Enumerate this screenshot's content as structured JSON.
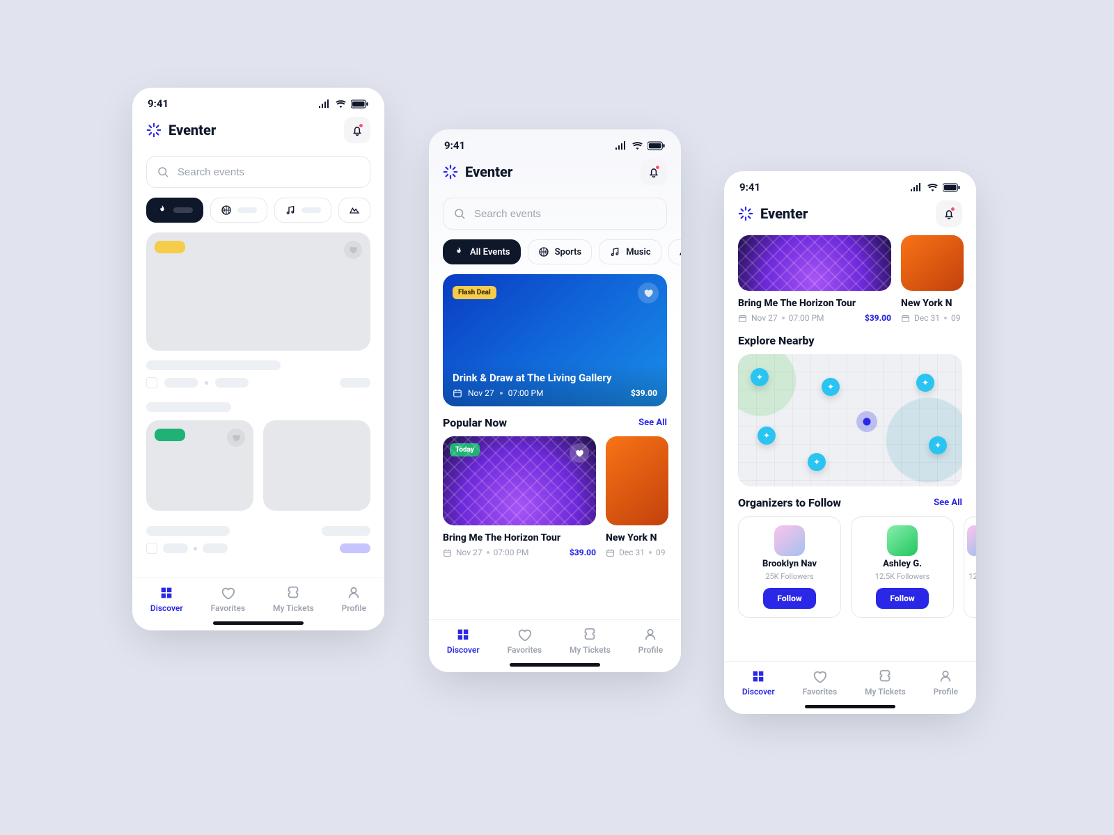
{
  "status": {
    "time": "9:41"
  },
  "app": {
    "name": "Eventer"
  },
  "search": {
    "placeholder": "Search events"
  },
  "chips": {
    "all": "All Events",
    "sports": "Sports",
    "music": "Music"
  },
  "feature": {
    "badge": "Flash Deal",
    "title": "Drink & Draw at The Living Gallery",
    "date": "Nov 27",
    "time": "07:00 PM",
    "price": "$39.00"
  },
  "sections": {
    "popular": "Popular Now",
    "explore": "Explore Nearby",
    "organizers": "Organizers to Follow",
    "see_all": "See All"
  },
  "popular": [
    {
      "badge": "Today",
      "title": "Bring Me The Horizon Tour",
      "date": "Nov 27",
      "time": "07:00 PM",
      "price": "$39.00"
    },
    {
      "title": "New York N",
      "date": "Dec 31",
      "time": "09"
    }
  ],
  "organizers": [
    {
      "name": "Brooklyn Nav",
      "followers": "25K Followers",
      "cta": "Follow"
    },
    {
      "name": "Ashley G.",
      "followers": "12.5K Followers",
      "cta": "Follow"
    },
    {
      "name": "",
      "followers": "12."
    }
  ],
  "tabs": {
    "discover": "Discover",
    "favorites": "Favorites",
    "tickets": "My Tickets",
    "profile": "Profile"
  }
}
